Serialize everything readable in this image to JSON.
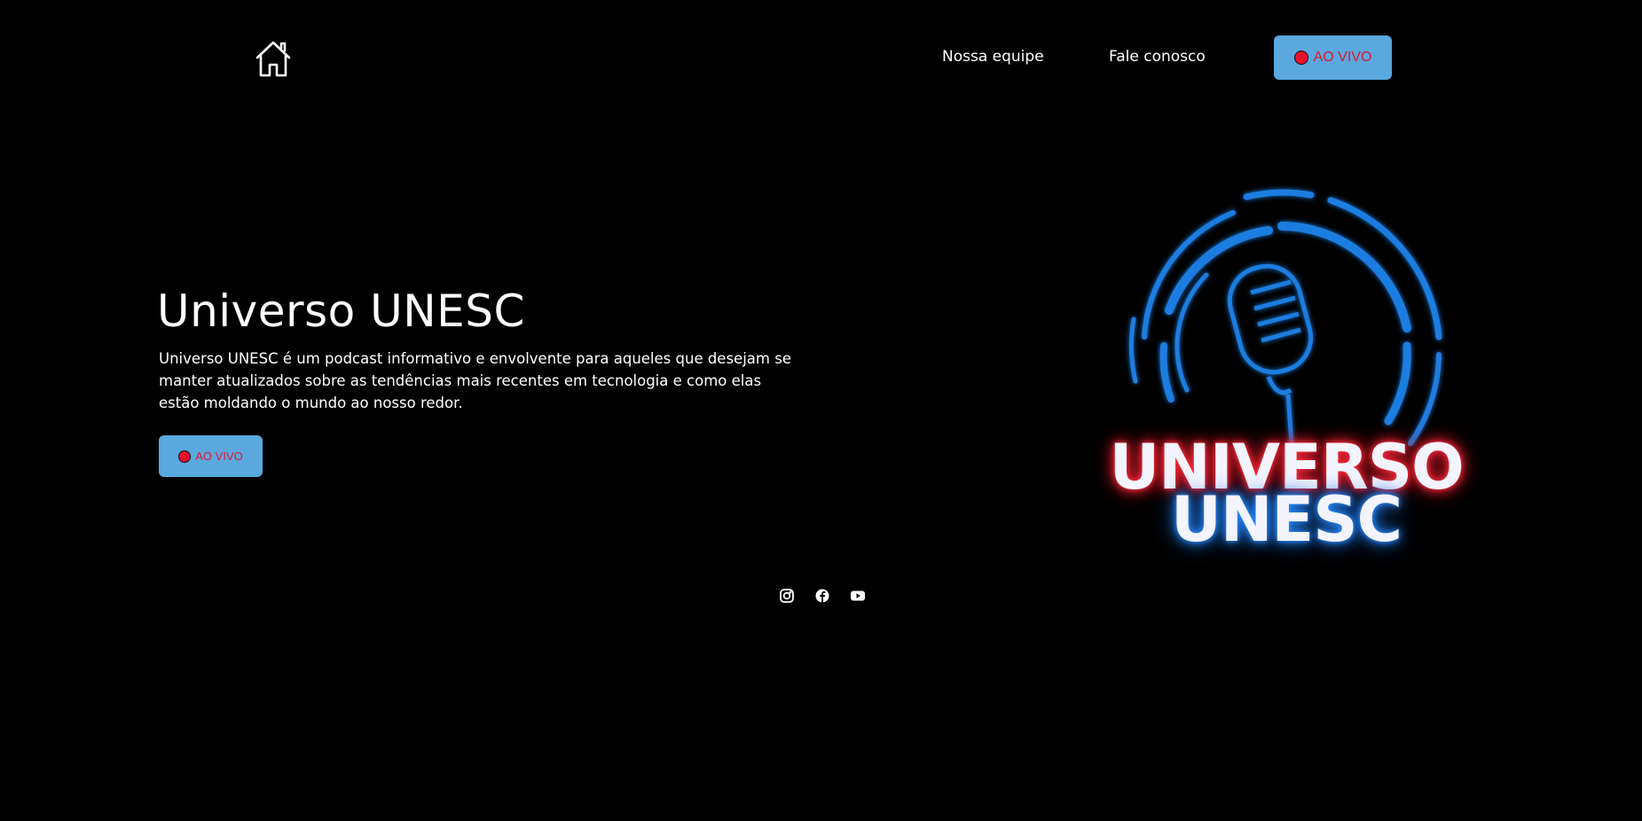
{
  "header": {
    "home_icon": "home-icon",
    "nav": [
      {
        "label": "Nossa equipe"
      },
      {
        "label": "Fale conosco"
      }
    ],
    "live_button": {
      "label": "AO VIVO",
      "icon": "red-dot-icon"
    }
  },
  "hero": {
    "title": "Universo UNESC",
    "description": "Universo UNESC é um podcast informativo e envolvente para aqueles que desejam se manter atualizados sobre as tendências mais recentes em tecnologia e como elas estão moldando o mundo ao nosso redor.",
    "live_button": {
      "label": "AO VIVO",
      "icon": "red-dot-icon"
    }
  },
  "logo": {
    "line1": "UNIVERSO",
    "line2": "UNESC",
    "icon": "microphone-icon"
  },
  "socials": [
    {
      "icon": "instagram-icon"
    },
    {
      "icon": "facebook-icon"
    },
    {
      "icon": "youtube-icon"
    }
  ],
  "colors": {
    "background": "#000000",
    "button_bg": "#5aa8de",
    "live_red": "#e0162e",
    "logo_blue": "#1e7de0",
    "logo_red_glow": "#ff2a3a"
  }
}
